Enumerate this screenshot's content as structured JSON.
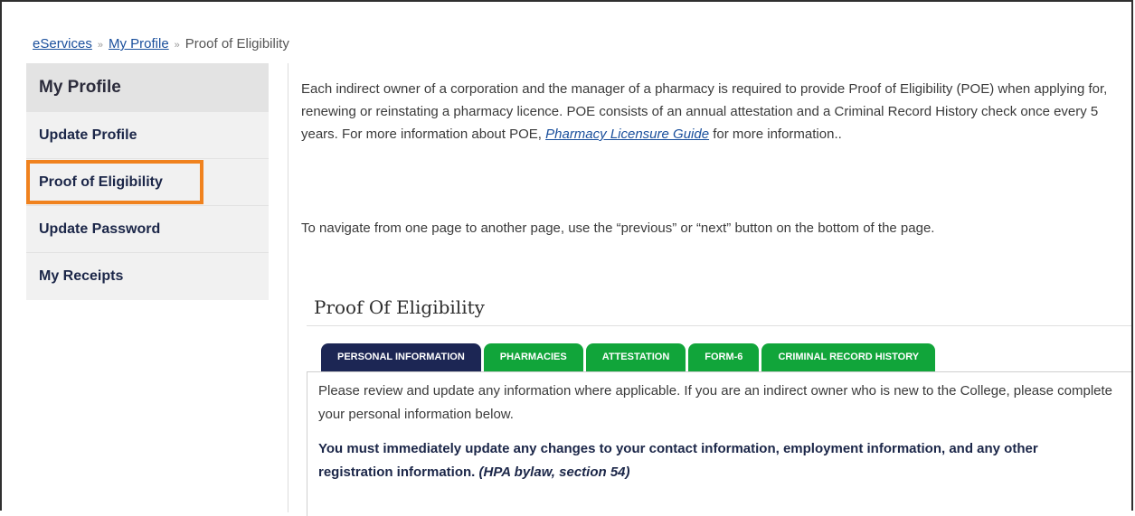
{
  "breadcrumb": {
    "items": [
      "eServices",
      "My Profile"
    ],
    "current": "Proof of Eligibility",
    "separator": "»"
  },
  "sidebar": {
    "title": "My Profile",
    "items": [
      {
        "label": "Update Profile"
      },
      {
        "label": "Proof of Eligibility"
      },
      {
        "label": "Update Password"
      },
      {
        "label": "My Receipts"
      }
    ]
  },
  "main": {
    "intro_part1": "Each indirect owner of a corporation and the manager of a pharmacy is required to provide Proof of Eligibility (POE) when applying for, renewing or reinstating a pharmacy licence.  POE consists of an annual attestation and a Criminal Record History check once every 5 years.  For more information about POE, ",
    "intro_link": "Pharmacy Licensure Guide",
    "intro_part2": " for more information..",
    "nav_note": "To navigate from one page to another page, use the “previous” or “next” button on the bottom of the page.",
    "section_title": "Proof Of Eligibility",
    "tabs": [
      {
        "label": "PERSONAL INFORMATION"
      },
      {
        "label": "PHARMACIES"
      },
      {
        "label": "ATTESTATION"
      },
      {
        "label": "FORM-6"
      },
      {
        "label": "CRIMINAL RECORD HISTORY"
      }
    ],
    "panel_text": "Please review and update any information where applicable.  If you are an indirect owner who is new to the College, please complete your personal information below.",
    "panel_bold": "You must immediately update any changes to your contact information, employment information, and any other registration information.",
    "panel_bold_ref": "(HPA bylaw, section 54)"
  },
  "colors": {
    "highlight": "#f0821e",
    "tab_active": "#1c2654",
    "tab_inactive": "#11a53a",
    "link": "#1a4f9c"
  }
}
